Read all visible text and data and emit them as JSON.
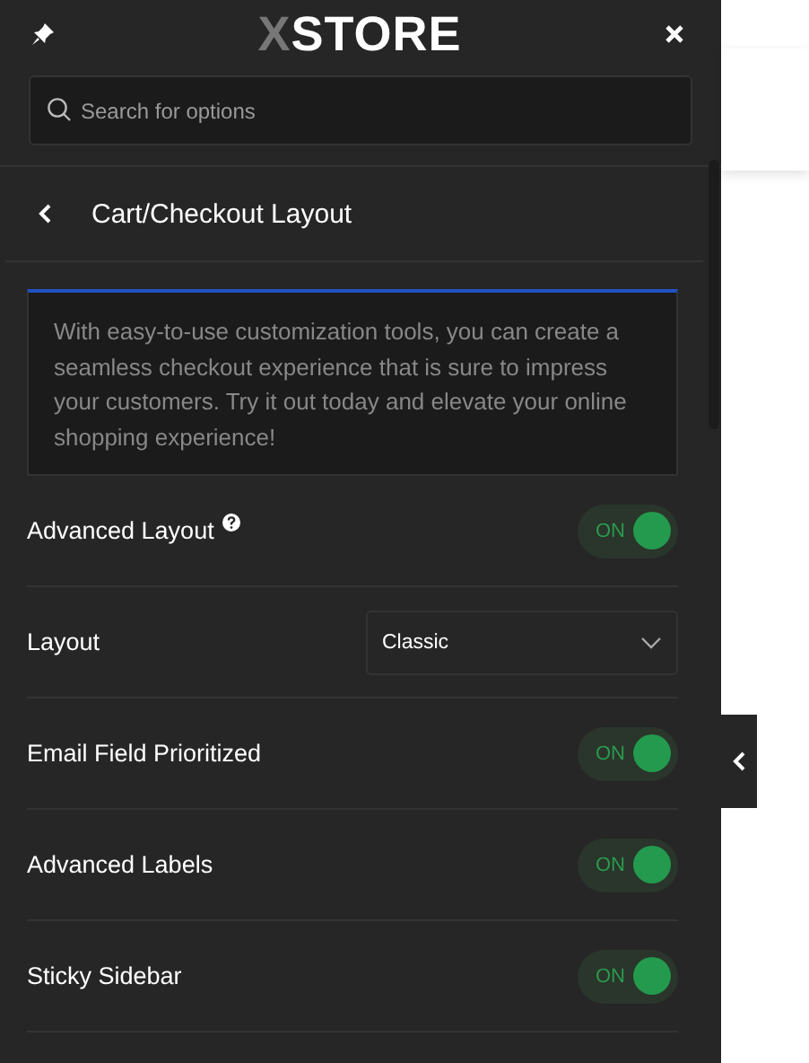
{
  "header": {
    "logo_mark": "X",
    "logo_text": "STORE"
  },
  "search": {
    "placeholder": "Search for options"
  },
  "section": {
    "title": "Cart/Checkout Layout"
  },
  "notice": "With easy-to-use customization tools, you can create a seamless checkout experience that is sure to impress your customers. Try it out today and elevate your online shopping experience!",
  "settings": [
    {
      "kind": "toggle",
      "label": "Advanced Layout",
      "help": true,
      "on": true,
      "state_text": "ON"
    },
    {
      "kind": "select",
      "label": "Layout",
      "value": "Classic"
    },
    {
      "kind": "toggle",
      "label": "Email Field Prioritized",
      "on": true,
      "state_text": "ON"
    },
    {
      "kind": "toggle",
      "label": "Advanced Labels",
      "on": true,
      "state_text": "ON"
    },
    {
      "kind": "toggle",
      "label": "Sticky Sidebar",
      "on": true,
      "state_text": "ON"
    }
  ]
}
